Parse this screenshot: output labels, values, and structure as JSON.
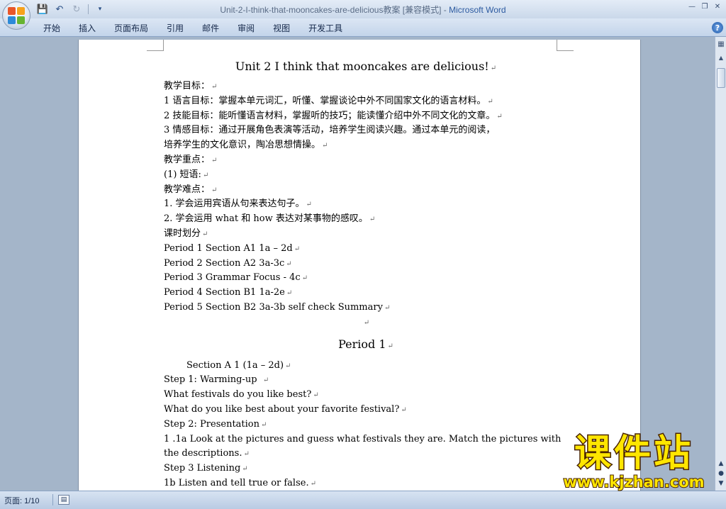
{
  "window": {
    "title": "Unit-2-I-think-that-mooncakes-are-delicious教案 [兼容模式] - ",
    "app_name": "Microsoft Word"
  },
  "ribbon": {
    "tabs": [
      "开始",
      "插入",
      "页面布局",
      "引用",
      "邮件",
      "审阅",
      "视图",
      "开发工具"
    ]
  },
  "document": {
    "title": "Unit 2 I think that mooncakes are delicious!",
    "lines": [
      "教学目标：",
      "1 语言目标：掌握本单元词汇，听懂、掌握谈论中外不同国家文化的语言材料。",
      "2  技能目标：能听懂语言材料，掌握听的技巧；能读懂介绍中外不同文化的文章。",
      "3  情感目标：通过开展角色表演等活动，培养学生阅读兴趣。通过本单元的阅读，",
      "培养学生的文化意识，陶冶思想情操。",
      "教学重点：",
      "(1)  短语:",
      "教学难点：",
      "1.  学会运用宾语从句来表达句子。",
      "2.  学会运用 what 和 how 表达对某事物的感叹。",
      "课时划分",
      "Period 1 Section A1 1a – 2d",
      "Period 2 Section A2 3a-3c",
      "Period 3 Grammar Focus - 4c",
      "Period 4 Section B1 1a-2e",
      "Period 5 Section B2 3a-3b self check Summary"
    ],
    "period_heading": "Period    1",
    "section_heading": "Section A 1 (1a – 2d)",
    "lines2": [
      "Step 1: Warming-up",
      "What festivals do you like best?",
      "What do you like best about your favorite festival?",
      "Step 2: Presentation",
      "1 .1a Look at the pictures and guess what festivals they are. Match the pictures with",
      "the descriptions.",
      "Step 3 Listening",
      "1b Listen and tell true or false."
    ]
  },
  "status": {
    "page": "页面: 1/10"
  },
  "watermark": {
    "main": "课件站",
    "url": "www.kjzhan.com"
  }
}
